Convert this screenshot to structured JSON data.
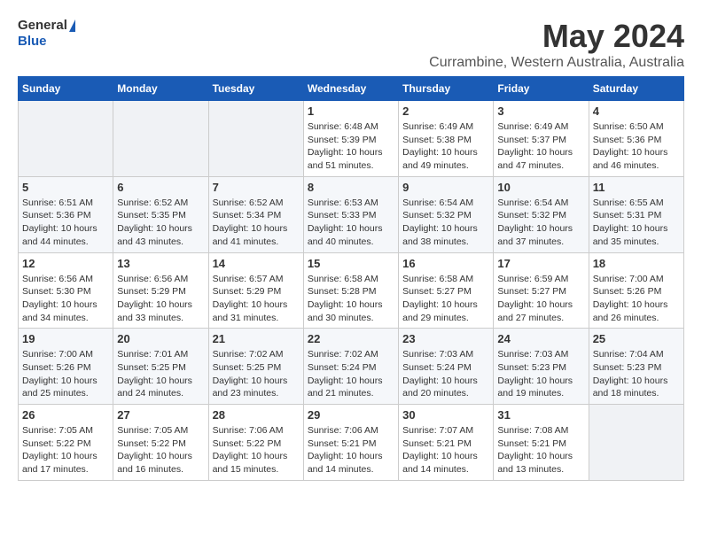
{
  "header": {
    "logo_line1": "General",
    "logo_line2": "Blue",
    "month_title": "May 2024",
    "location": "Currambine, Western Australia, Australia"
  },
  "days_of_week": [
    "Sunday",
    "Monday",
    "Tuesday",
    "Wednesday",
    "Thursday",
    "Friday",
    "Saturday"
  ],
  "weeks": [
    [
      {
        "day": "",
        "info": ""
      },
      {
        "day": "",
        "info": ""
      },
      {
        "day": "",
        "info": ""
      },
      {
        "day": "1",
        "info": "Sunrise: 6:48 AM\nSunset: 5:39 PM\nDaylight: 10 hours\nand 51 minutes."
      },
      {
        "day": "2",
        "info": "Sunrise: 6:49 AM\nSunset: 5:38 PM\nDaylight: 10 hours\nand 49 minutes."
      },
      {
        "day": "3",
        "info": "Sunrise: 6:49 AM\nSunset: 5:37 PM\nDaylight: 10 hours\nand 47 minutes."
      },
      {
        "day": "4",
        "info": "Sunrise: 6:50 AM\nSunset: 5:36 PM\nDaylight: 10 hours\nand 46 minutes."
      }
    ],
    [
      {
        "day": "5",
        "info": "Sunrise: 6:51 AM\nSunset: 5:36 PM\nDaylight: 10 hours\nand 44 minutes."
      },
      {
        "day": "6",
        "info": "Sunrise: 6:52 AM\nSunset: 5:35 PM\nDaylight: 10 hours\nand 43 minutes."
      },
      {
        "day": "7",
        "info": "Sunrise: 6:52 AM\nSunset: 5:34 PM\nDaylight: 10 hours\nand 41 minutes."
      },
      {
        "day": "8",
        "info": "Sunrise: 6:53 AM\nSunset: 5:33 PM\nDaylight: 10 hours\nand 40 minutes."
      },
      {
        "day": "9",
        "info": "Sunrise: 6:54 AM\nSunset: 5:32 PM\nDaylight: 10 hours\nand 38 minutes."
      },
      {
        "day": "10",
        "info": "Sunrise: 6:54 AM\nSunset: 5:32 PM\nDaylight: 10 hours\nand 37 minutes."
      },
      {
        "day": "11",
        "info": "Sunrise: 6:55 AM\nSunset: 5:31 PM\nDaylight: 10 hours\nand 35 minutes."
      }
    ],
    [
      {
        "day": "12",
        "info": "Sunrise: 6:56 AM\nSunset: 5:30 PM\nDaylight: 10 hours\nand 34 minutes."
      },
      {
        "day": "13",
        "info": "Sunrise: 6:56 AM\nSunset: 5:29 PM\nDaylight: 10 hours\nand 33 minutes."
      },
      {
        "day": "14",
        "info": "Sunrise: 6:57 AM\nSunset: 5:29 PM\nDaylight: 10 hours\nand 31 minutes."
      },
      {
        "day": "15",
        "info": "Sunrise: 6:58 AM\nSunset: 5:28 PM\nDaylight: 10 hours\nand 30 minutes."
      },
      {
        "day": "16",
        "info": "Sunrise: 6:58 AM\nSunset: 5:27 PM\nDaylight: 10 hours\nand 29 minutes."
      },
      {
        "day": "17",
        "info": "Sunrise: 6:59 AM\nSunset: 5:27 PM\nDaylight: 10 hours\nand 27 minutes."
      },
      {
        "day": "18",
        "info": "Sunrise: 7:00 AM\nSunset: 5:26 PM\nDaylight: 10 hours\nand 26 minutes."
      }
    ],
    [
      {
        "day": "19",
        "info": "Sunrise: 7:00 AM\nSunset: 5:26 PM\nDaylight: 10 hours\nand 25 minutes."
      },
      {
        "day": "20",
        "info": "Sunrise: 7:01 AM\nSunset: 5:25 PM\nDaylight: 10 hours\nand 24 minutes."
      },
      {
        "day": "21",
        "info": "Sunrise: 7:02 AM\nSunset: 5:25 PM\nDaylight: 10 hours\nand 23 minutes."
      },
      {
        "day": "22",
        "info": "Sunrise: 7:02 AM\nSunset: 5:24 PM\nDaylight: 10 hours\nand 21 minutes."
      },
      {
        "day": "23",
        "info": "Sunrise: 7:03 AM\nSunset: 5:24 PM\nDaylight: 10 hours\nand 20 minutes."
      },
      {
        "day": "24",
        "info": "Sunrise: 7:03 AM\nSunset: 5:23 PM\nDaylight: 10 hours\nand 19 minutes."
      },
      {
        "day": "25",
        "info": "Sunrise: 7:04 AM\nSunset: 5:23 PM\nDaylight: 10 hours\nand 18 minutes."
      }
    ],
    [
      {
        "day": "26",
        "info": "Sunrise: 7:05 AM\nSunset: 5:22 PM\nDaylight: 10 hours\nand 17 minutes."
      },
      {
        "day": "27",
        "info": "Sunrise: 7:05 AM\nSunset: 5:22 PM\nDaylight: 10 hours\nand 16 minutes."
      },
      {
        "day": "28",
        "info": "Sunrise: 7:06 AM\nSunset: 5:22 PM\nDaylight: 10 hours\nand 15 minutes."
      },
      {
        "day": "29",
        "info": "Sunrise: 7:06 AM\nSunset: 5:21 PM\nDaylight: 10 hours\nand 14 minutes."
      },
      {
        "day": "30",
        "info": "Sunrise: 7:07 AM\nSunset: 5:21 PM\nDaylight: 10 hours\nand 14 minutes."
      },
      {
        "day": "31",
        "info": "Sunrise: 7:08 AM\nSunset: 5:21 PM\nDaylight: 10 hours\nand 13 minutes."
      },
      {
        "day": "",
        "info": ""
      }
    ]
  ]
}
